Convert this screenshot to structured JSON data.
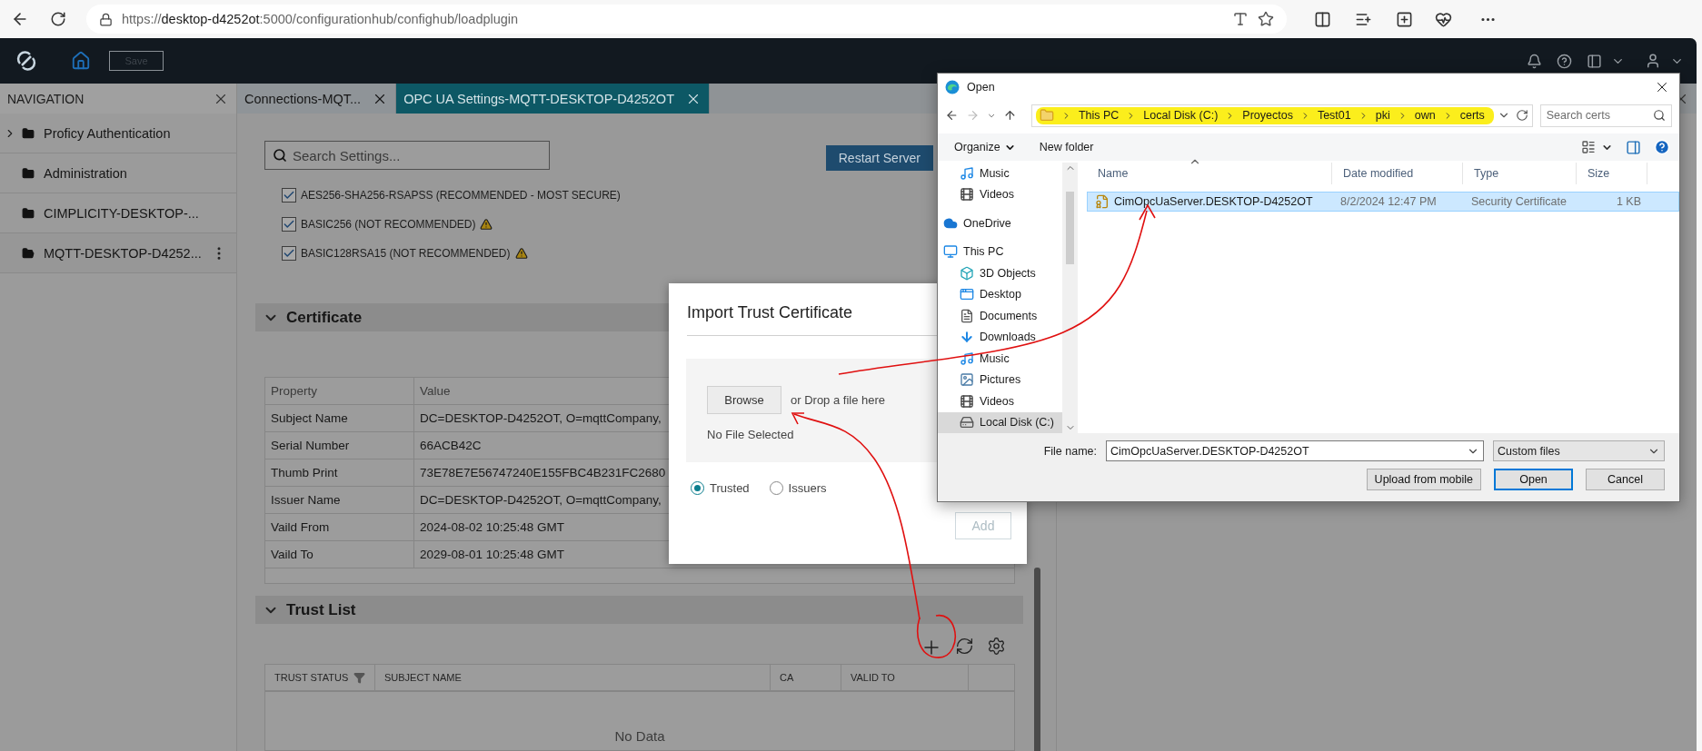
{
  "browser": {
    "url": "https://**desktop-d4252ot**:5000/configurationhub/confighub/loadplugin"
  },
  "app_header": {
    "save_button": {
      "label": "Save",
      "disabled": true
    }
  },
  "navigation": {
    "title": "NAVIGATION",
    "items": [
      {
        "label": "Proficy Authentication",
        "expandable": true,
        "selected": false
      },
      {
        "label": "Administration",
        "expandable": false,
        "selected": false
      },
      {
        "label": "CIMPLICITY-DESKTOP-...",
        "expandable": false,
        "selected": false
      },
      {
        "label": "MQTT-DESKTOP-D4252...",
        "expandable": false,
        "selected": true
      }
    ]
  },
  "tabs": [
    {
      "label": "Connections-MQT...",
      "selected": false
    },
    {
      "label": "OPC UA Settings-MQTT-DESKTOP-D4252OT",
      "selected": true
    }
  ],
  "settings": {
    "search_placeholder": "Search Settings...",
    "restart_button": "Restart Server",
    "policies": [
      {
        "label": "AES256-SHA256-RSAPSS (RECOMMENDED - MOST SECURE)",
        "checked": true,
        "warning": false
      },
      {
        "label": "BASIC256 (NOT RECOMMENDED)",
        "checked": true,
        "warning": true
      },
      {
        "label": "BASIC128RSA15 (NOT RECOMMENDED)",
        "checked": true,
        "warning": true
      }
    ]
  },
  "certificate": {
    "title": "Certificate",
    "expanded": true,
    "columns": [
      "Property",
      "Value"
    ],
    "rows": [
      [
        "Subject Name",
        "DC=DESKTOP-D4252OT, O=mqttCompany,"
      ],
      [
        "Serial Number",
        "66ACB42C"
      ],
      [
        "Thumb Print",
        "73E78E7E56747240E155FBC4B231FC2680"
      ],
      [
        "Issuer Name",
        "DC=DESKTOP-D4252OT, O=mqttCompany,"
      ],
      [
        "Vaild From",
        "2024-08-02 10:25:48 GMT"
      ],
      [
        "Vaild To",
        "2029-08-01 10:25:48 GMT"
      ]
    ]
  },
  "trust_list": {
    "title": "Trust List",
    "expanded": true,
    "columns": [
      {
        "label": "TRUST STATUS",
        "filter": true
      },
      {
        "label": "SUBJECT NAME",
        "filter": false
      },
      {
        "label": "CA",
        "filter": false
      },
      {
        "label": "VALID TO",
        "filter": false
      }
    ],
    "empty_text": "No Data"
  },
  "import_dialog": {
    "title": "Import Trust Certificate",
    "browse_button": "Browse",
    "drop_hint": "or Drop a file here",
    "file_status": "No File Selected",
    "options": [
      {
        "label": "Trusted",
        "selected": true
      },
      {
        "label": "Issuers",
        "selected": false
      }
    ],
    "add_button": {
      "label": "Add",
      "disabled": true
    }
  },
  "open_dialog": {
    "title": "Open",
    "path": [
      "This PC",
      "Local Disk (C:)",
      "Proyectos",
      "Test01",
      "pki",
      "own",
      "certs"
    ],
    "search_placeholder": "Search certs",
    "toolbar": [
      "Organize",
      "New folder"
    ],
    "nav_tree": [
      {
        "children": [
          {
            "label": "Music",
            "kind": "music",
            "selected": false
          },
          {
            "label": "Videos",
            "kind": "video",
            "selected": false
          }
        ]
      },
      {
        "label": "OneDrive",
        "kind": "cloud",
        "selected": false
      },
      {
        "label": "This PC",
        "kind": "pc",
        "selected": false,
        "children": [
          {
            "label": "3D Objects",
            "kind": "cube",
            "selected": false
          },
          {
            "label": "Desktop",
            "kind": "desktop",
            "selected": false
          },
          {
            "label": "Documents",
            "kind": "document",
            "selected": false
          },
          {
            "label": "Downloads",
            "kind": "download",
            "selected": false
          },
          {
            "label": "Music",
            "kind": "music",
            "selected": false
          },
          {
            "label": "Pictures",
            "kind": "pictures",
            "selected": false
          },
          {
            "label": "Videos",
            "kind": "video",
            "selected": false
          },
          {
            "label": "Local Disk (C:)",
            "kind": "drive",
            "selected": true
          }
        ]
      }
    ],
    "columns": [
      "Name",
      "Date modified",
      "Type",
      "Size"
    ],
    "files": [
      {
        "name": "CimOpcUaServer.DESKTOP-D4252OT",
        "date": "8/2/2024 12:47 PM",
        "type": "Security Certificate",
        "size": "1 KB",
        "selected": true
      }
    ],
    "file_name_label": "File name:",
    "file_name": "CimOpcUaServer.DESKTOP-D4252OT",
    "file_type": "Custom files",
    "buttons": [
      {
        "label": "Upload from mobile",
        "default": false
      },
      {
        "label": "Open",
        "default": true
      },
      {
        "label": "Cancel",
        "default": false
      }
    ]
  }
}
